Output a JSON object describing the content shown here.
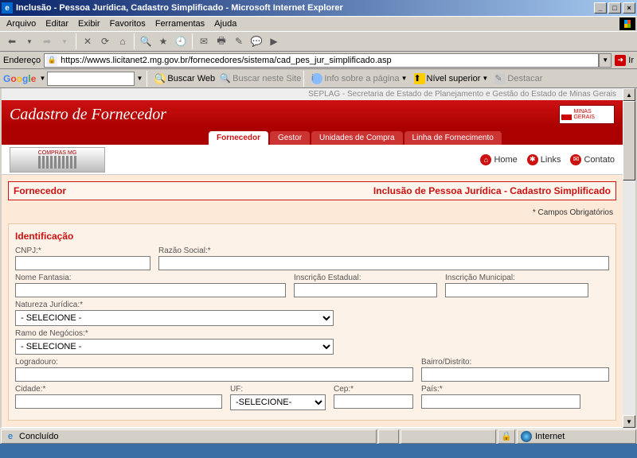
{
  "window": {
    "title": "Inclusão - Pessoa Jurídica, Cadastro Simplificado - Microsoft Internet Explorer"
  },
  "menu": {
    "arquivo": "Arquivo",
    "editar": "Editar",
    "exibir": "Exibir",
    "favoritos": "Favoritos",
    "ferramentas": "Ferramentas",
    "ajuda": "Ajuda"
  },
  "addr": {
    "label": "Endereço",
    "url": "https://wwws.licitanet2.mg.gov.br/fornecedores/sistema/cad_pes_jur_simplificado.asp",
    "go": "Ir"
  },
  "google": {
    "buscar_web": "Buscar Web",
    "buscar_site": "Buscar neste Site",
    "info": "Info sobre a página",
    "nivel": "Nível superior",
    "destacar": "Destacar"
  },
  "header": {
    "seplag": "SEPLAG - Secretaria de Estado de Planejamento e Gestão do Estado de Minas Gerais",
    "title": "Cadastro de Fornecedor",
    "logo_text": "MINAS GERAIS",
    "tabs": {
      "fornecedor": "Fornecedor",
      "gestor": "Gestor",
      "unidades": "Unidades de Compra",
      "linha": "Linha de Fornecimento"
    },
    "banner": "COMPRAS MG",
    "links": {
      "home": "Home",
      "links": "Links",
      "contato": "Contato"
    }
  },
  "form": {
    "title_left": "Fornecedor",
    "title_right": "Inclusão de Pessoa Jurídica - Cadastro Simplificado",
    "required": "Campos Obrigatórios",
    "section_ident": "Identificação",
    "labels": {
      "cnpj": "CNPJ:",
      "razao": "Razão Social:",
      "nome_fantasia": "Nome Fantasia:",
      "inscr_est": "Inscrição Estadual:",
      "inscr_mun": "Inscrição Municipal:",
      "nat_jur": "Natureza Jurídica:",
      "ramo": "Ramo de Negócios:",
      "logradouro": "Logradouro:",
      "bairro": "Bairro/Distrito:",
      "cidade": "Cidade:",
      "uf": "UF:",
      "cep": "Cep:",
      "pais": "País:"
    },
    "select_default": "- SELECIONE -",
    "uf_default": "-SELECIONE-",
    "asterisk": "*"
  },
  "status": {
    "concluido": "Concluído",
    "zone": "Internet"
  }
}
